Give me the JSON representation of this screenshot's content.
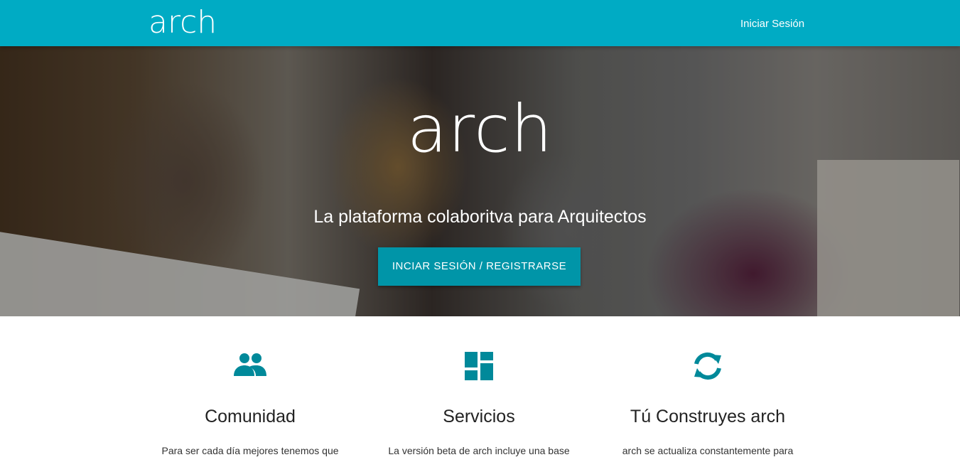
{
  "navbar": {
    "brand": "arch",
    "login_link": "Iniciar Sesión"
  },
  "hero": {
    "title": "arch",
    "subtitle": "La plataforma colaboritva para Arquitectos",
    "cta_label": "INCIAR SESIÓN / REGISTRARSE"
  },
  "features": [
    {
      "icon": "people-icon",
      "title": "Comunidad",
      "text": "Para ser cada día mejores tenemos que"
    },
    {
      "icon": "dashboard-icon",
      "title": "Servicios",
      "text": "La versión beta de arch incluye una base"
    },
    {
      "icon": "sync-icon",
      "title": "Tú Construyes arch",
      "text": "arch se actualiza constantemente para"
    }
  ],
  "colors": {
    "brand": "#00abc4",
    "button": "#0095a8",
    "icon": "#00899a"
  }
}
